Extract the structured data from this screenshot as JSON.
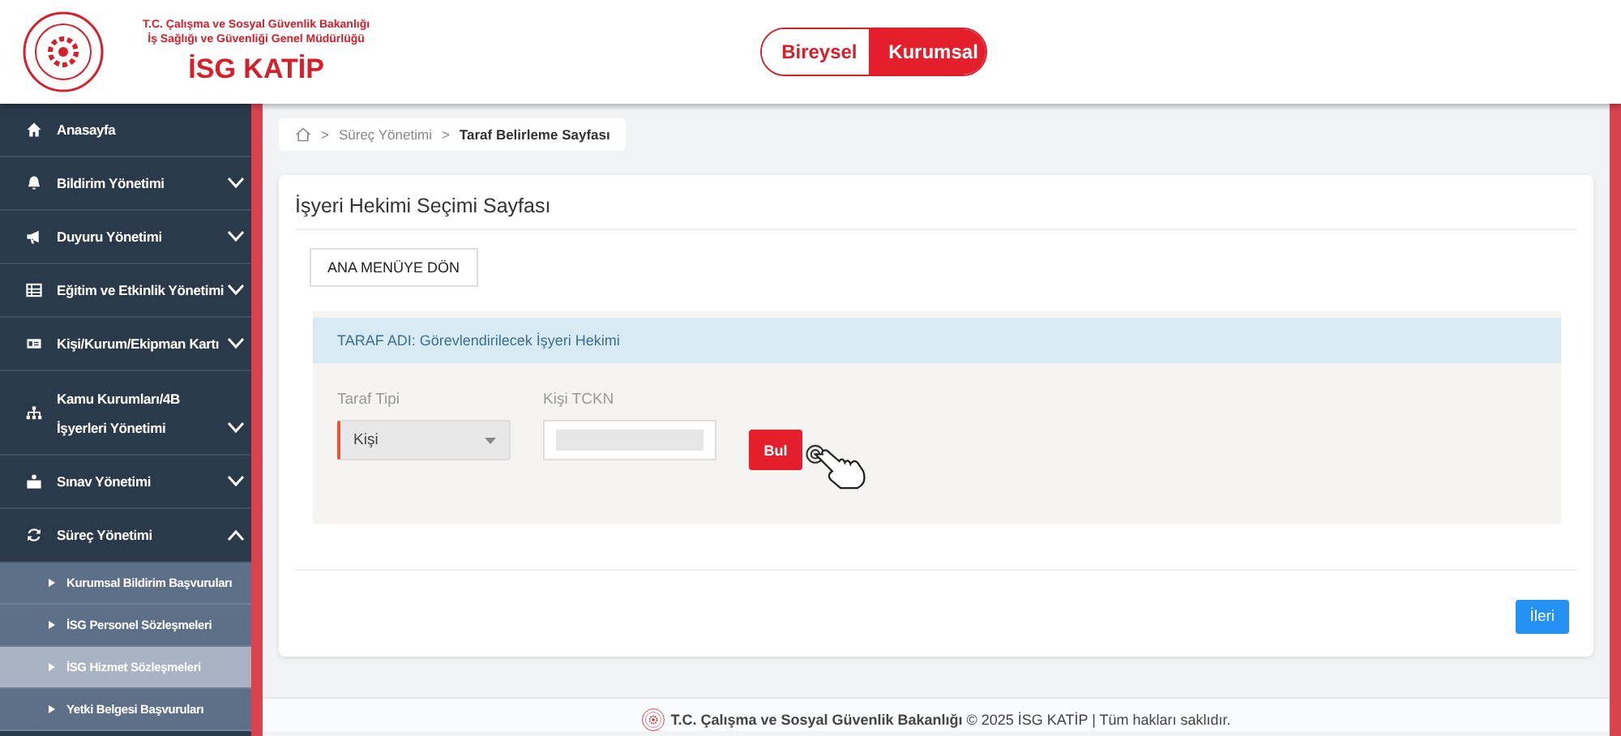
{
  "header": {
    "ministry_line_1": "T.C. Çalışma ve Sosyal Güvenlik Bakanlığı",
    "ministry_line_2": "İş Sağlığı ve Güvenliği Genel Müdürlüğü",
    "brand": "İSG KATİP",
    "toggle": [
      {
        "label": "Bireysel",
        "selected": false
      },
      {
        "label": "Kurumsal",
        "selected": true
      }
    ]
  },
  "sidebar": {
    "items": [
      {
        "label": "Anasayfa",
        "kind": "link"
      },
      {
        "label": "Bildirim Yönetimi",
        "kind": "group",
        "expanded": false
      },
      {
        "label": "Duyuru Yönetimi",
        "kind": "group",
        "expanded": false
      },
      {
        "label": "Eğitim ve Etkinlik Yönetimi",
        "kind": "group",
        "expanded": false
      },
      {
        "label": "Kişi/Kurum/Ekipman Kartı",
        "kind": "group",
        "expanded": false
      },
      {
        "label": "Kamu Kurumları/4B İşyerleri Yönetimi",
        "kind": "group",
        "expanded": false
      },
      {
        "label": "Sınav Yönetimi",
        "kind": "group",
        "expanded": false
      },
      {
        "label": "Süreç Yönetimi",
        "kind": "group",
        "expanded": true,
        "children": [
          {
            "label": "Kurumsal Bildirim Başvuruları",
            "selected": false
          },
          {
            "label": "İSG Personel Sözleşmeleri",
            "selected": false
          },
          {
            "label": "İSG Hizmet Sözleşmeleri",
            "selected": true
          },
          {
            "label": "Yetki Belgesi Başvuruları",
            "selected": false
          }
        ]
      }
    ]
  },
  "breadcrumb": [
    {
      "separator": ">",
      "label": "Süreç Yönetimi"
    },
    {
      "separator": ">",
      "label": "Taraf Belirleme Sayfası"
    }
  ],
  "page_title": "İşyeri Hekimi Seçimi Sayfası",
  "back_button": "ANA MENÜYE DÖN",
  "party_banner": "TARAF ADI: Görevlendirilecek İşyeri Hekimi",
  "form": {
    "party_type": {
      "label": "Taraf Tipi",
      "value": "Kişi"
    },
    "tckn": {
      "label": "Kişi TCKN"
    },
    "search_button": "Bul"
  },
  "next_button": "İleri",
  "footer": "**T.C. Çalışma ve Sosyal Güvenlik Bakanlığı** © 2025 İSG KATİP | Tüm hakları saklıdır."
}
